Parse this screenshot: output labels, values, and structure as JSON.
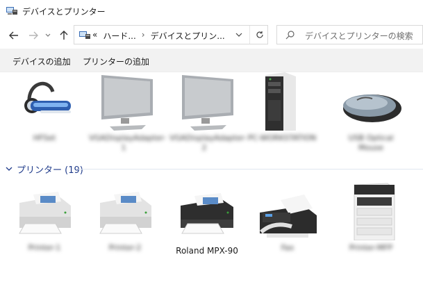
{
  "window": {
    "title": "デバイスとプリンター"
  },
  "address": {
    "prefix": "«",
    "crumbs": [
      "ハード...",
      "デバイスとプリン..."
    ],
    "separator": "›"
  },
  "search": {
    "placeholder": "デバイスとプリンターの検索"
  },
  "commands": {
    "add_device": "デバイスの追加",
    "add_printer": "プリンターの追加"
  },
  "devices": [
    {
      "icon": "headset-icon",
      "label": "HFSet"
    },
    {
      "icon": "monitor-icon",
      "label": "VGADisplayAdapter-1"
    },
    {
      "icon": "monitor-icon",
      "label": "VGADisplayAdapter-2"
    },
    {
      "icon": "server-tower-icon",
      "label": "PC-WORKSTATION"
    },
    {
      "icon": "mouse-icon",
      "label": "USB Optical Mouse"
    }
  ],
  "printers_group": {
    "title": "プリンター (19)"
  },
  "printers": [
    {
      "icon": "printer-icon",
      "label": "Printer-1",
      "blurred": true
    },
    {
      "icon": "printer-icon",
      "label": "Printer-2",
      "blurred": true
    },
    {
      "icon": "printer-dark-icon",
      "label": "Roland MPX-90",
      "blurred": false
    },
    {
      "icon": "fax-icon",
      "label": "Fax",
      "blurred": true
    },
    {
      "icon": "multifunction-printer-icon",
      "label": "Printer-MFP",
      "blurred": true
    }
  ]
}
